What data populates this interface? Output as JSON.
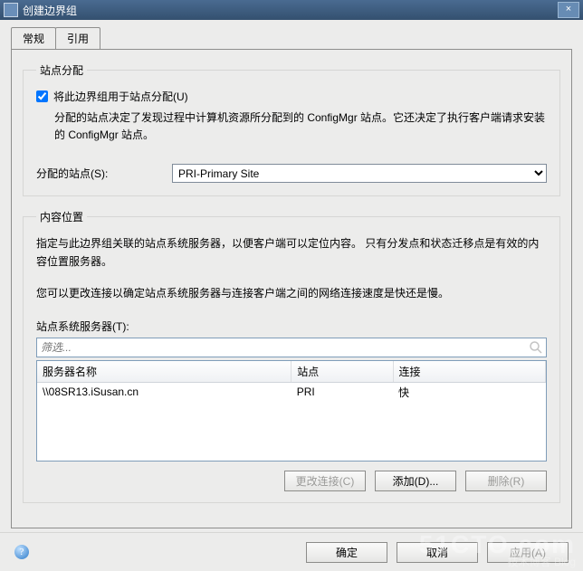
{
  "window": {
    "title": "创建边界组"
  },
  "tabs": {
    "general": "常规",
    "references": "引用"
  },
  "siteAssignment": {
    "legend": "站点分配",
    "checkbox_label": "将此边界组用于站点分配(U)",
    "checkbox_checked": true,
    "description": "分配的站点决定了发现过程中计算机资源所分配到的 ConfigMgr 站点。它还决定了执行客户端请求安装的 ConfigMgr 站点。",
    "assigned_label": "分配的站点(S):",
    "assigned_value": "PRI-Primary Site"
  },
  "contentLocation": {
    "legend": "内容位置",
    "desc1": "指定与此边界组关联的站点系统服务器，以便客户端可以定位内容。    只有分发点和状态迁移点是有效的内容位置服务器。",
    "desc2": "您可以更改连接以确定站点系统服务器与连接客户端之间的网络连接速度是快还是慢。",
    "servers_label": "站点系统服务器(T):",
    "filter_placeholder": "筛选...",
    "columns": {
      "name": "服务器名称",
      "site": "站点",
      "conn": "连接"
    },
    "rows": [
      {
        "name": "\\\\08SR13.iSusan.cn",
        "site": "PRI",
        "conn": "快"
      }
    ],
    "btn_change": "更改连接(C)",
    "btn_add": "添加(D)...",
    "btn_remove": "删除(R)"
  },
  "bottom": {
    "ok": "确定",
    "cancel": "取消",
    "apply": "应用(A)"
  },
  "watermark": {
    "big": "51CTO.com",
    "small": "技术博客 Blog"
  }
}
